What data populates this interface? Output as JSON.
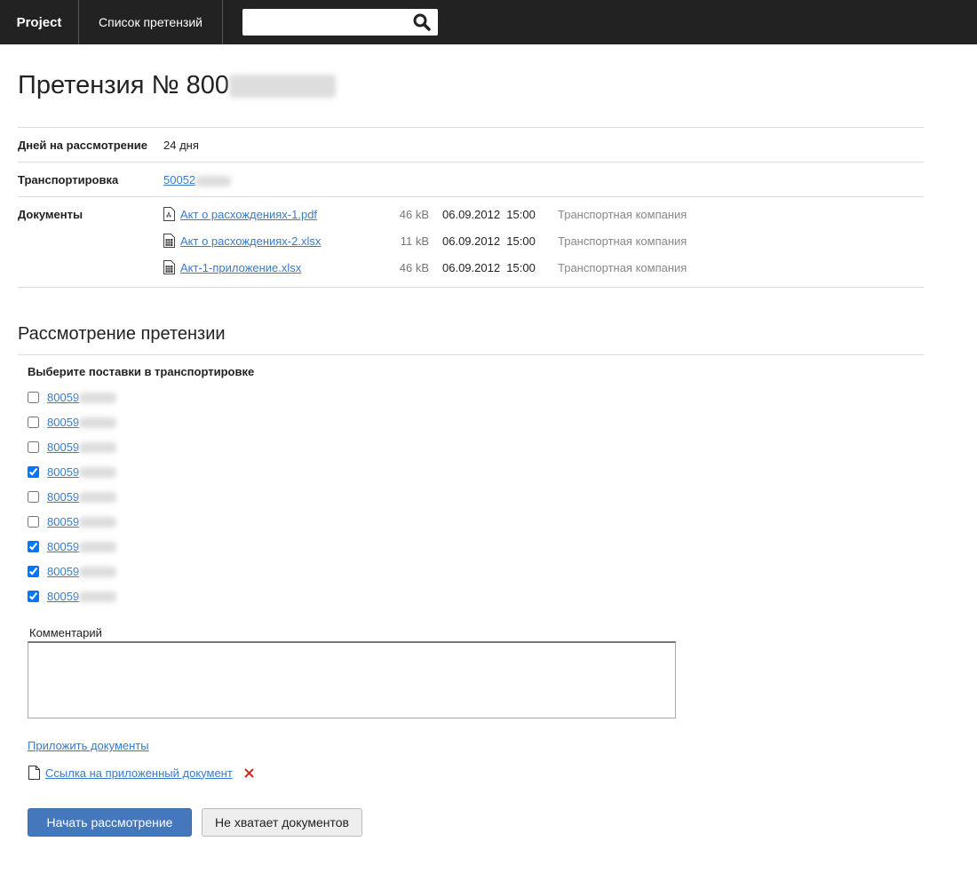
{
  "nav": {
    "brand": "Project",
    "claims_list": "Список претензий",
    "search_placeholder": ""
  },
  "title": "Претензия № 800",
  "fields": {
    "days_label": "Дней на рассмотрение",
    "days_value": "24 дня",
    "transport_label": "Транспортировка",
    "transport_value": "50052",
    "documents_label": "Документы"
  },
  "documents": [
    {
      "icon": "pdf-file-icon",
      "name": "Акт о расхождениях-1.pdf",
      "size": "46 kB",
      "date": "06.09.2012  15:00",
      "source": "Транспортная компания"
    },
    {
      "icon": "spreadsheet-file-icon",
      "name": "Акт о расхождениях-2.xlsx",
      "size": "11 kB",
      "date": "06.09.2012  15:00",
      "source": "Транспортная компания"
    },
    {
      "icon": "spreadsheet-file-icon",
      "name": "Акт-1-приложение.xlsx",
      "size": "46 kB",
      "date": "06.09.2012  15:00",
      "source": "Транспортная компания"
    }
  ],
  "review": {
    "heading": "Рассмотрение претензии",
    "select_label": "Выберите поставки в транспортировке",
    "deliveries": [
      {
        "id": "80059",
        "checked": false
      },
      {
        "id": "80059",
        "checked": false
      },
      {
        "id": "80059",
        "checked": false
      },
      {
        "id": "80059",
        "checked": true
      },
      {
        "id": "80059",
        "checked": false
      },
      {
        "id": "80059",
        "checked": false
      },
      {
        "id": "80059",
        "checked": true
      },
      {
        "id": "80059",
        "checked": true
      },
      {
        "id": "80059",
        "checked": true
      }
    ],
    "comment_label": "Комментарий",
    "comment_value": "",
    "attach_link": "Приложить документы",
    "attached_doc": "Ссылка на приложенный документ",
    "start_button": "Начать рассмотрение",
    "missing_button": "Не хватает документов"
  }
}
